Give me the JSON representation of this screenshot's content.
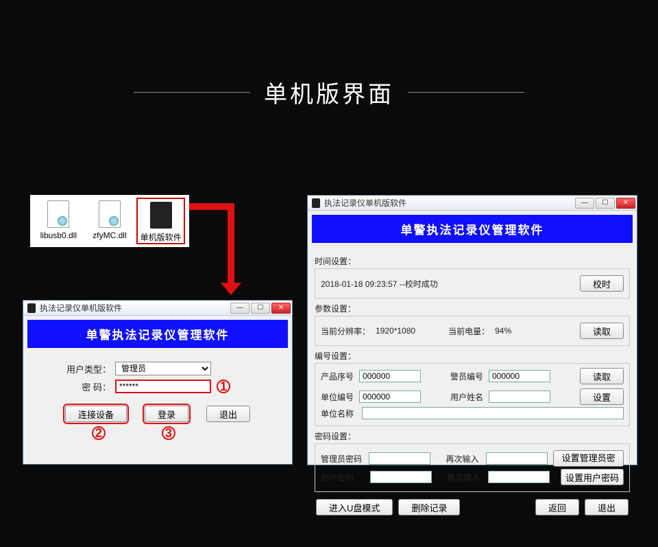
{
  "page_title": "单机版界面",
  "files": {
    "a": "libusb0.dll",
    "b": "zfyMC.dll",
    "c": "单机版软件"
  },
  "markers": {
    "one": "1",
    "two": "2",
    "three": "3"
  },
  "login_win": {
    "title": "执法记录仪单机版软件",
    "header": "单警执法记录仪管理软件",
    "user_type_label": "用户类型：",
    "user_type_value": "管理员",
    "password_label": "密    码：",
    "password_value": "******",
    "btn_connect": "连接设备",
    "btn_login": "登录",
    "btn_exit": "退出"
  },
  "main_win": {
    "title": "执法记录仪单机版软件",
    "header": "单警执法记录仪管理软件",
    "time": {
      "label": "时间设置：",
      "value": "2018-01-18 09:23:57 --校时成功",
      "btn": "校时"
    },
    "param": {
      "label": "参数设置：",
      "resolution_label": "当前分辨率：",
      "resolution_value": "1920*1080",
      "battery_label": "当前电量：",
      "battery_value": "94%",
      "btn": "读取"
    },
    "id": {
      "label": "编号设置：",
      "product_label": "产品序号",
      "product_value": "000000",
      "officer_label": "警员编号",
      "officer_value": "000000",
      "unit_id_label": "单位编号",
      "unit_id_value": "000000",
      "user_name_label": "用户姓名",
      "user_name_value": "",
      "unit_name_label": "单位名称",
      "unit_name_value": "",
      "btn_read": "读取",
      "btn_set": "设置"
    },
    "pwd": {
      "label": "密码设置：",
      "admin_label": "管理员密码",
      "again_label": "再次输入",
      "btn_admin": "设置管理员密码",
      "user_label": "用户密码",
      "btn_user": "设置用户密码"
    },
    "bottom": {
      "udisk": "进入U盘模式",
      "delete": "删除记录",
      "back": "返回",
      "exit": "退出"
    }
  }
}
